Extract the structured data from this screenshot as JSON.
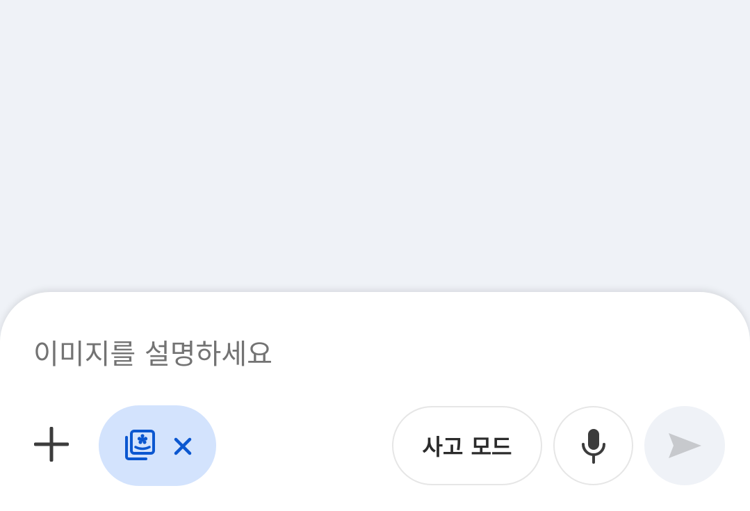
{
  "composer": {
    "input_placeholder": "이미지를 설명하세요",
    "input_value": ""
  },
  "toolbar": {
    "add_icon": "plus-icon",
    "attached_chip": {
      "icon": "image-gallery-icon",
      "close_icon": "close-icon",
      "color": "#0b57d0",
      "background": "#d3e3fd"
    },
    "thinking_mode_label": "사고 모드",
    "mic_icon": "microphone-icon",
    "send_icon": "send-icon"
  },
  "colors": {
    "page_background": "#eff2f7",
    "composer_background": "#ffffff",
    "send_disabled": "#c7c9cd"
  }
}
